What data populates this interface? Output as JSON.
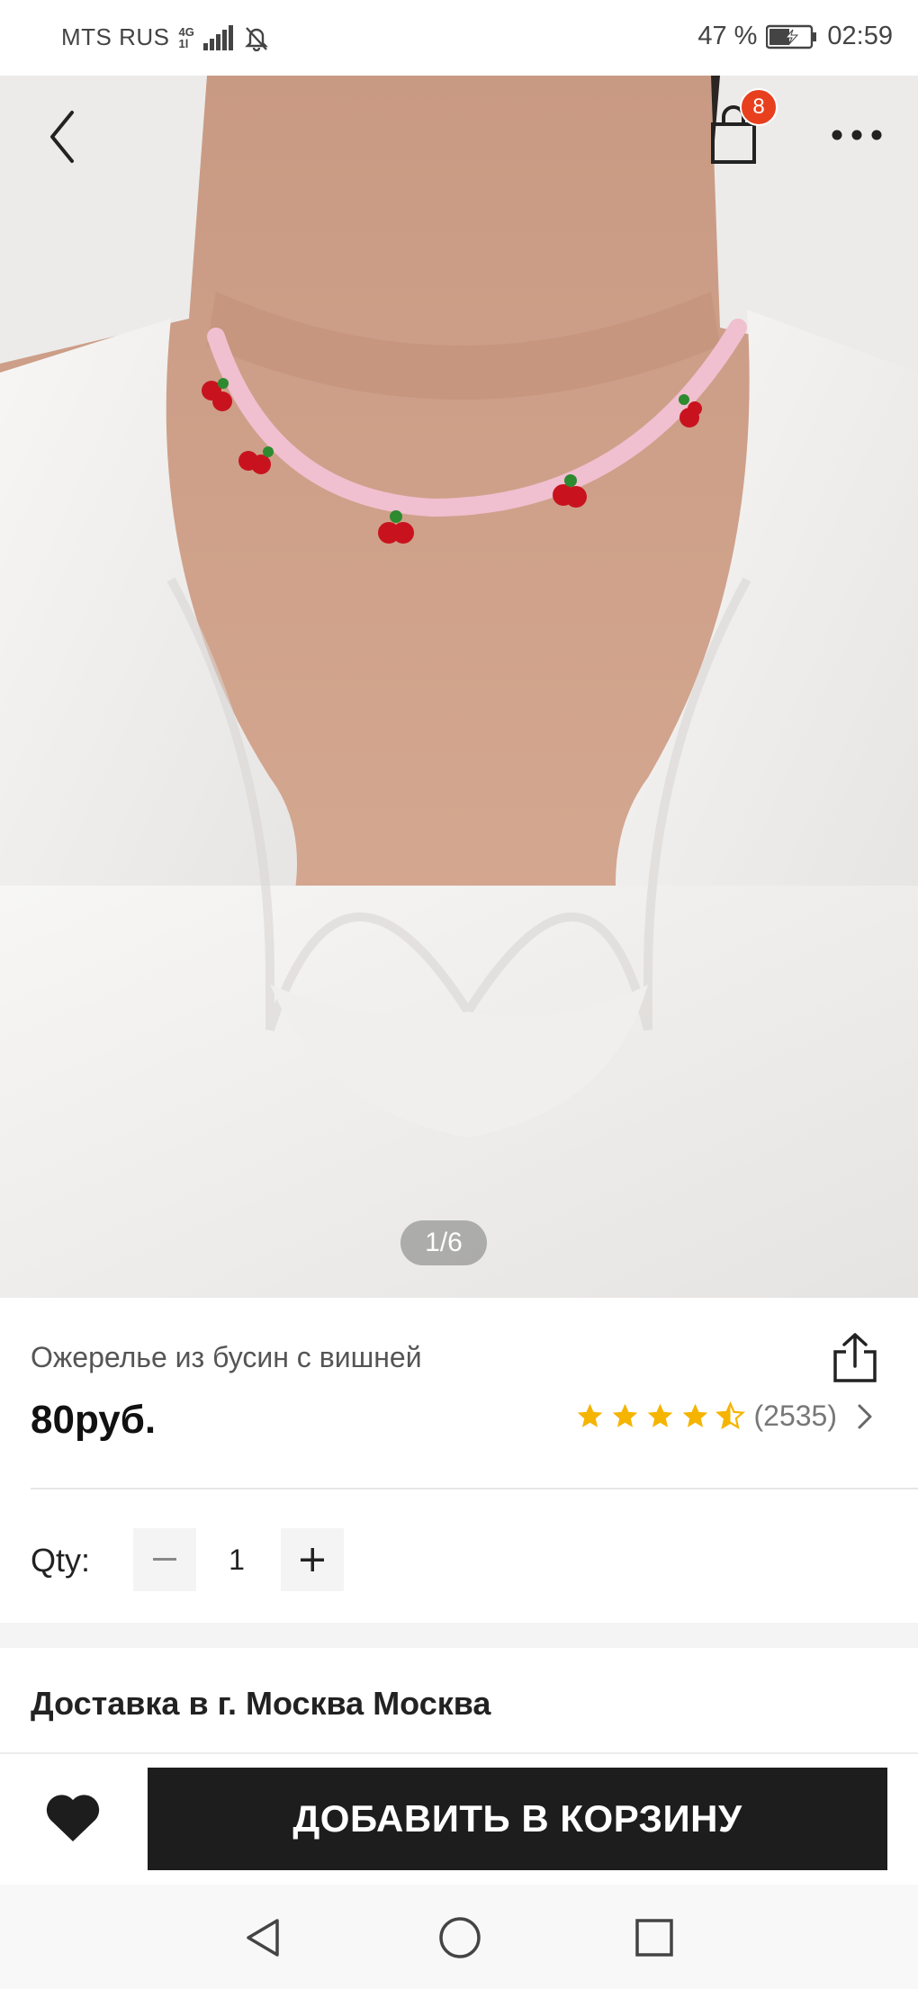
{
  "status_bar": {
    "carrier": "MTS RUS",
    "network_top": "4G",
    "network_bottom": "1l",
    "battery_percent": "47 %",
    "time": "02:59"
  },
  "header": {
    "back_icon": "chevron-left-icon",
    "cart_icon": "shopping-bag-icon",
    "cart_count": "8",
    "more_icon": "more-horizontal-icon"
  },
  "gallery": {
    "counter": "1/6"
  },
  "product": {
    "title": "Ожерелье из бусин с вишней",
    "price": "80руб.",
    "rating_value": 4.5,
    "review_count": "(2535)",
    "star_color": "#f5b400"
  },
  "quantity": {
    "label": "Qty:",
    "minus": "−",
    "value": "1",
    "plus": "+"
  },
  "delivery": {
    "title": "Доставка в г. Москва Москва"
  },
  "actions": {
    "add_to_cart": "ДОБАВИТЬ В КОРЗИНУ",
    "wishlist_icon": "heart-icon"
  },
  "colors": {
    "accent_badge": "#e8401f",
    "primary_button": "#1d1d1d"
  }
}
